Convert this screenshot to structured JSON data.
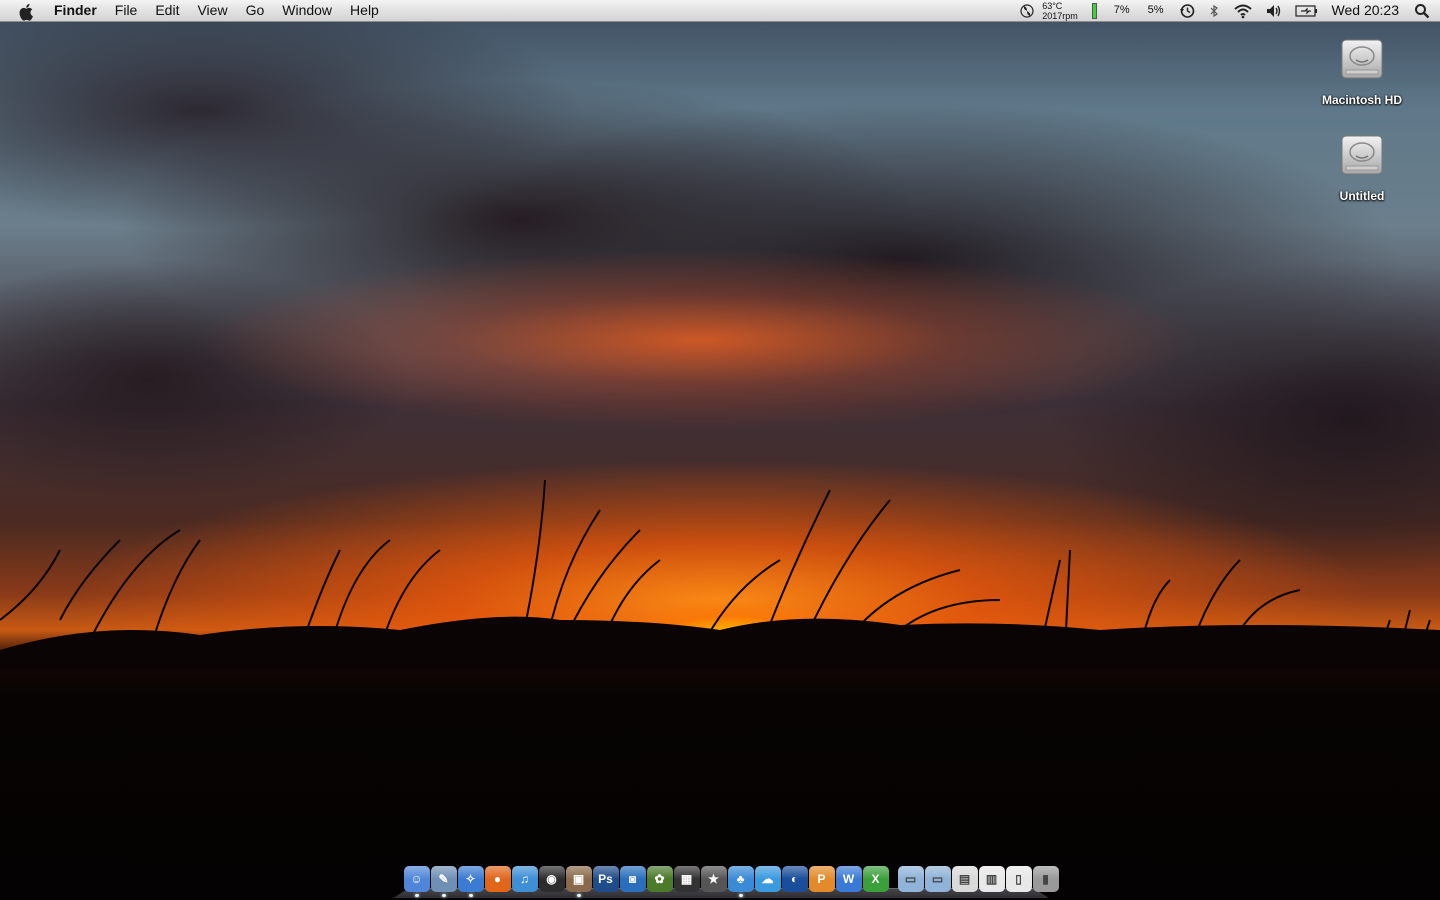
{
  "menubar": {
    "app_name": "Finder",
    "menus": [
      "File",
      "Edit",
      "View",
      "Go",
      "Window",
      "Help"
    ],
    "temperature": "63°C",
    "fan_speed": "2017rpm",
    "cpu_percent": "7%",
    "mem_percent": "5%",
    "clock": "Wed 20:23",
    "icons": [
      "apple-icon",
      "fan-icon",
      "battery-level-bar",
      "time-machine-icon",
      "bluetooth-icon",
      "wifi-icon",
      "volume-icon",
      "battery-icon",
      "spotlight-icon"
    ]
  },
  "desktop_icons": [
    {
      "label": "Macintosh HD",
      "icon": "hard-drive-icon"
    },
    {
      "label": "Untitled",
      "icon": "hard-drive-icon"
    }
  ],
  "dock": {
    "apps": [
      {
        "name": "finder",
        "glyph": "☺",
        "bg": "#4f86d9",
        "running": true
      },
      {
        "name": "preview",
        "glyph": "✎",
        "bg": "#6f8fb5",
        "running": true
      },
      {
        "name": "safari",
        "glyph": "✧",
        "bg": "#3b7bd1",
        "running": true
      },
      {
        "name": "firefox",
        "glyph": "●",
        "bg": "#e1661a",
        "running": false
      },
      {
        "name": "itunes",
        "glyph": "♫",
        "bg": "#3e8fd6",
        "running": false
      },
      {
        "name": "dvd-player",
        "glyph": "◉",
        "bg": "#2d2d2d",
        "running": false
      },
      {
        "name": "iphoto",
        "glyph": "▣",
        "bg": "#8a6a4a",
        "running": true
      },
      {
        "name": "photoshop",
        "glyph": "Ps",
        "bg": "#1f4d8a",
        "running": false
      },
      {
        "name": "image-capture",
        "glyph": "◙",
        "bg": "#2a6fbd",
        "running": false
      },
      {
        "name": "app-pineapple",
        "glyph": "✿",
        "bg": "#4a7a2a",
        "running": false
      },
      {
        "name": "imovie",
        "glyph": "▦",
        "bg": "#333",
        "running": false
      },
      {
        "name": "imovie-star",
        "glyph": "★",
        "bg": "#555",
        "running": false
      },
      {
        "name": "adium",
        "glyph": "♣",
        "bg": "#3a8ad6",
        "running": true
      },
      {
        "name": "ichat",
        "glyph": "☁",
        "bg": "#3a9ae0",
        "running": false
      },
      {
        "name": "google-earth",
        "glyph": "◐",
        "bg": "#1a4e9a",
        "running": false
      },
      {
        "name": "powerpoint",
        "glyph": "P",
        "bg": "#e38a2a",
        "running": false
      },
      {
        "name": "word",
        "glyph": "W",
        "bg": "#3a7ad6",
        "running": false
      },
      {
        "name": "excel",
        "glyph": "X",
        "bg": "#3aa03a",
        "running": false
      }
    ],
    "stacks": [
      {
        "name": "folder-applications",
        "glyph": "▭",
        "bg": "#8fb3d9"
      },
      {
        "name": "folder-documents",
        "glyph": "▭",
        "bg": "#8fb3d9"
      },
      {
        "name": "folder-downloads",
        "glyph": "▤",
        "bg": "#d9d9d9"
      },
      {
        "name": "document-stack",
        "glyph": "▥",
        "bg": "#e8e8e8"
      },
      {
        "name": "document-pdf",
        "glyph": "▯",
        "bg": "#e8e8e8"
      },
      {
        "name": "trash",
        "glyph": "▮",
        "bg": "#9a9a9a"
      }
    ]
  }
}
